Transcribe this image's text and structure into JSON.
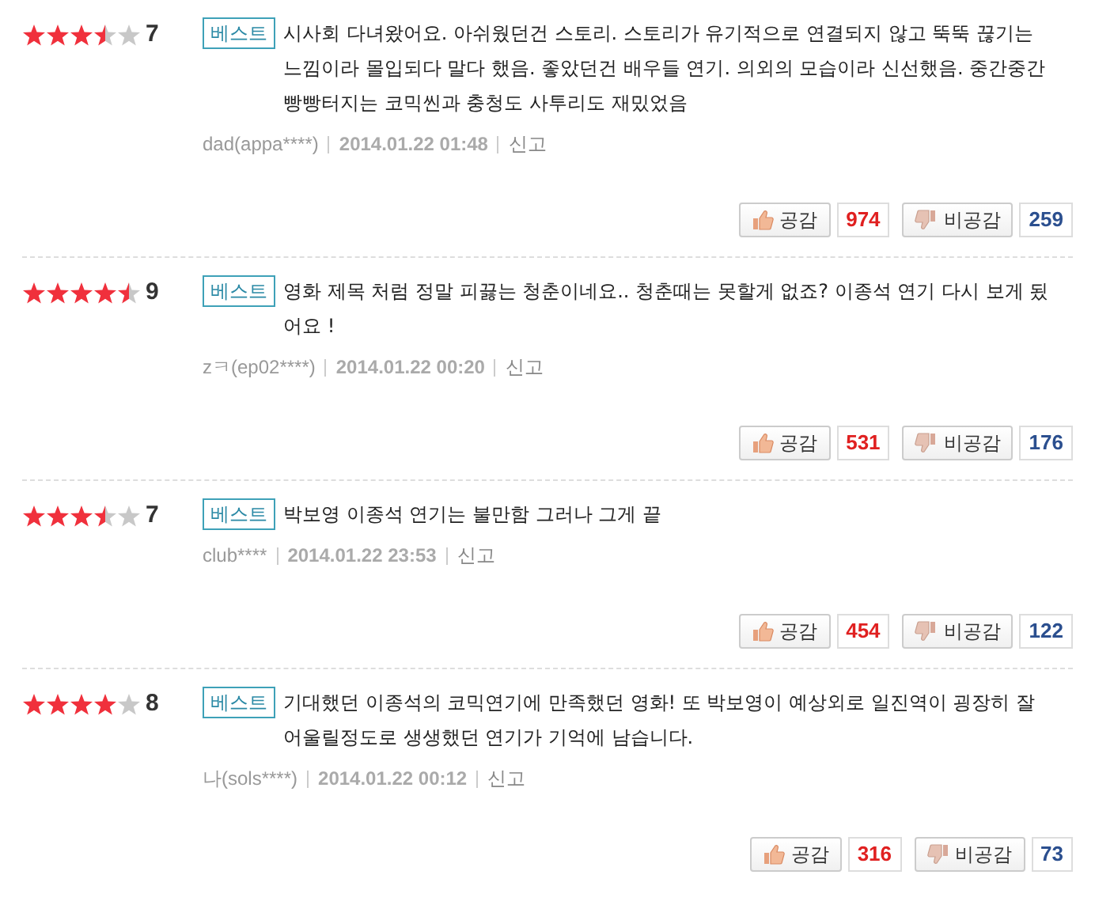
{
  "reviews": [
    {
      "stars": 3.5,
      "score": "7",
      "badge": "베스트",
      "text": "시사회 다녀왔어요. 아쉬웠던건 스토리. 스토리가 유기적으로 연결되지 않고 뚝뚝 끊기는 느낌이라 몰입되다 말다 했음. 좋았던건 배우들 연기. 의외의 모습이라 신선했음. 중간중간 빵빵터지는 코믹씬과 충청도 사투리도 재밌었음",
      "author": "dad(appa****)",
      "date": "2014.01.22 01:48",
      "report": "신고",
      "like_label": "공감",
      "likes": "974",
      "dislike_label": "비공감",
      "dislikes": "259"
    },
    {
      "stars": 4.5,
      "score": "9",
      "badge": "베스트",
      "text": "영화 제목 처럼 정말 피끓는 청춘이네요.. 청춘때는 못할게 없죠? 이종석 연기 다시 보게 됬어요 !",
      "author": "zㅋ(ep02****)",
      "date": "2014.01.22 00:20",
      "report": "신고",
      "like_label": "공감",
      "likes": "531",
      "dislike_label": "비공감",
      "dislikes": "176"
    },
    {
      "stars": 3.5,
      "score": "7",
      "badge": "베스트",
      "text": "박보영 이종석 연기는 불만함 그러나 그게 끝",
      "author": "club****",
      "date": "2014.01.22 23:53",
      "report": "신고",
      "like_label": "공감",
      "likes": "454",
      "dislike_label": "비공감",
      "dislikes": "122"
    },
    {
      "stars": 4,
      "score": "8",
      "badge": "베스트",
      "text": "기대했던 이종석의 코믹연기에 만족했던 영화! 또 박보영이 예상외로 일진역이 굉장히 잘 어울릴정도로 생생했던 연기가 기억에 남습니다.",
      "author": "나(sols****)",
      "date": "2014.01.22 00:12",
      "report": "신고",
      "like_label": "공감",
      "likes": "316",
      "dislike_label": "비공감",
      "dislikes": "73"
    }
  ]
}
